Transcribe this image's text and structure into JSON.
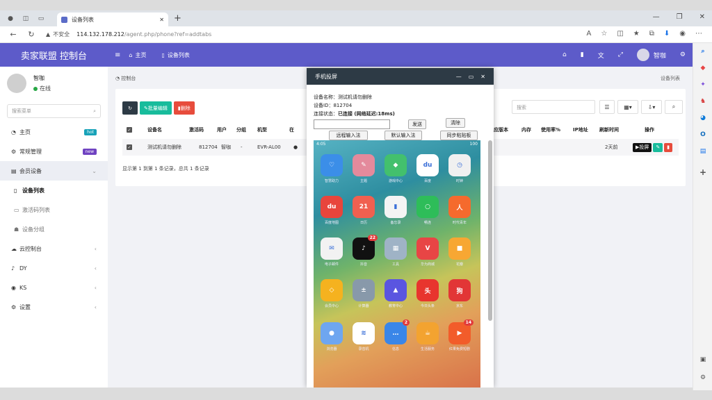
{
  "browser": {
    "tab_title": "设备列表",
    "url_warning": "不安全",
    "url_host": "114.132.178.212",
    "url_path": "/agent.php/phone?ref=addtabs"
  },
  "header": {
    "brand": "卖家联盟 控制台",
    "nav_home": "主页",
    "nav_devices": "设备列表",
    "user": "智咖",
    "color": "#5d5bc9"
  },
  "sidebar": {
    "user_name": "智咖",
    "user_status": "在线",
    "search_placeholder": "搜索菜单",
    "items": [
      {
        "label": "主页",
        "badge": "hot",
        "badge_color": "#17a2b8"
      },
      {
        "label": "常规管理",
        "badge": "new",
        "badge_color": "#6f42c1"
      },
      {
        "label": "会员设备"
      },
      {
        "label": "设备列表"
      },
      {
        "label": "激活码列表"
      },
      {
        "label": "设备分组"
      },
      {
        "label": "云控制台"
      },
      {
        "label": "DY"
      },
      {
        "label": "KS"
      },
      {
        "label": "设置"
      }
    ]
  },
  "content": {
    "breadcrumb": "控制台",
    "breadcrumb_right": "设备列表",
    "btn_edit": "批量编辑",
    "btn_delete": "删除",
    "search_placeholder": "搜索",
    "columns": [
      "设备名",
      "激活码",
      "用户",
      "分组",
      "机型",
      "在",
      "应版本",
      "内存",
      "使用率%",
      "IP地址",
      "刷新时间",
      "操作"
    ],
    "row": {
      "name": "测试机请勿删除",
      "code": "812704",
      "user": "智咖",
      "group": "-",
      "model": "EVR-AL00",
      "time": "2天前",
      "action": "投屏"
    },
    "page_info": "显示第 1 到第 1 条记录，总共 1 条记录"
  },
  "phone": {
    "title": "手机投屏",
    "device_name_label": "设备名称：",
    "device_name": "测试机请勿删除",
    "device_id_label": "设备ID：",
    "device_id": "812704",
    "conn_label": "连接状态：",
    "conn_status": "已连接 (网络延迟:18ms)",
    "btn_send": "发送",
    "btn_clear": "清除",
    "btn_remote_ime": "远程输入法",
    "btn_default_ime": "默认输入法",
    "btn_sync_clip": "同步粘贴板",
    "status_time": "4:05",
    "status_right": "100",
    "apps": [
      {
        "label": "智慧助力",
        "color": "#3b8ee8",
        "glyph": "♡"
      },
      {
        "label": "主题",
        "color": "#e48a9c",
        "glyph": "✎"
      },
      {
        "label": "游戏中心",
        "color": "#43c06d",
        "glyph": "◆"
      },
      {
        "label": "百度",
        "color": "#ffffff",
        "glyph": "du"
      },
      {
        "label": "时钟",
        "color": "#f0f0f0",
        "glyph": "◷"
      },
      {
        "label": "百度地图",
        "color": "#e8453c",
        "glyph": "du"
      },
      {
        "label": "日历",
        "color": "#f06050",
        "glyph": "21"
      },
      {
        "label": "备忘录",
        "color": "#f4f4f4",
        "glyph": "▮"
      },
      {
        "label": "畅连",
        "color": "#2ebd59",
        "glyph": "○"
      },
      {
        "label": "时代青年",
        "color": "#f56a2d",
        "glyph": "人"
      },
      {
        "label": "电子邮件",
        "color": "#f2f2f2",
        "glyph": "✉"
      },
      {
        "label": "抖音",
        "color": "#111111",
        "glyph": "♪",
        "badge": "22"
      },
      {
        "label": "工具",
        "color": "#9fb3c6",
        "glyph": "▦"
      },
      {
        "label": "华为商城",
        "color": "#e84545",
        "glyph": "V"
      },
      {
        "label": "花瓣",
        "color": "#f7a733",
        "glyph": "■"
      },
      {
        "label": "会员中心",
        "color": "#f5b21f",
        "glyph": "◇"
      },
      {
        "label": "计算器",
        "color": "#8899aa",
        "glyph": "±"
      },
      {
        "label": "教育中心",
        "color": "#5a55e0",
        "glyph": "▲"
      },
      {
        "label": "今日头条",
        "color": "#e8352e",
        "glyph": "头"
      },
      {
        "label": "京东",
        "color": "#e23636",
        "glyph": "狗"
      },
      {
        "label": "浏览器",
        "color": "#6ea6f0",
        "glyph": "●"
      },
      {
        "label": "录音机",
        "color": "#ffffff",
        "glyph": "≋"
      },
      {
        "label": "信息",
        "color": "#3a86e8",
        "glyph": "…",
        "badge": "2"
      },
      {
        "label": "生活服务",
        "color": "#f3a330",
        "glyph": "☕"
      },
      {
        "label": "红果免费短剧",
        "color": "#f25c2a",
        "glyph": "▶",
        "badge": "14"
      }
    ]
  }
}
